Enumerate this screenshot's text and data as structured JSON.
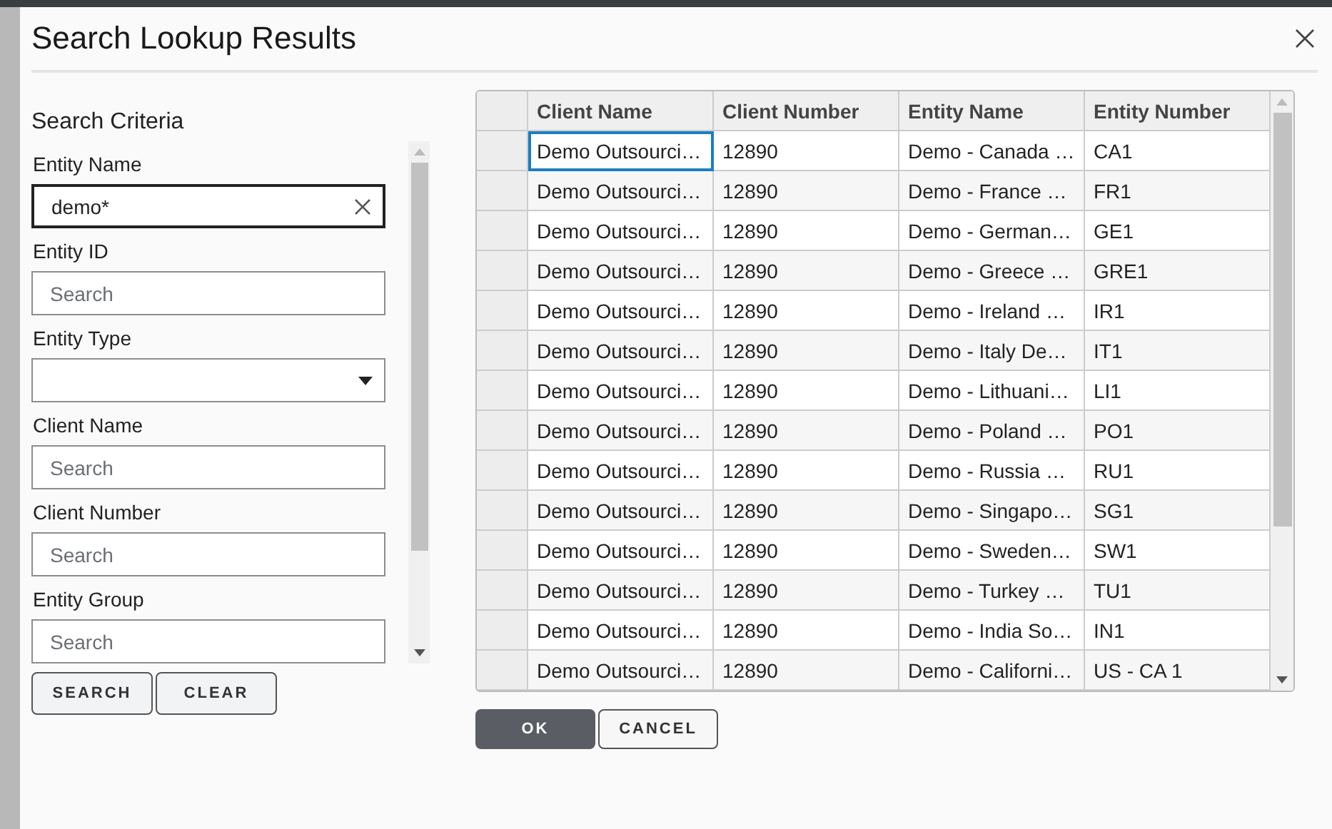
{
  "dialog": {
    "title": "Search Lookup Results"
  },
  "criteria": {
    "heading": "Search Criteria",
    "fields": [
      {
        "label": "Entity Name",
        "kind": "text",
        "value": "demo*",
        "focused": true
      },
      {
        "label": "Entity ID",
        "kind": "text",
        "placeholder": "Search",
        "focused": false
      },
      {
        "label": "Entity Type",
        "kind": "select",
        "focused": false
      },
      {
        "label": "Client Name",
        "kind": "text",
        "placeholder": "Search",
        "focused": false
      },
      {
        "label": "Client Number",
        "kind": "text",
        "placeholder": "Search",
        "focused": false
      },
      {
        "label": "Entity Group",
        "kind": "text",
        "placeholder": "Search",
        "focused": false
      }
    ],
    "buttons": [
      "SEARCH",
      "CLEAR"
    ]
  },
  "table": {
    "columns": [
      "Client Name",
      "Client Number",
      "Entity Name",
      "Entity Number"
    ],
    "rows": [
      {
        "cells": [
          "Demo Outsourci…",
          "12890",
          "Demo - Canada …",
          "CA1"
        ],
        "focused": true
      },
      {
        "cells": [
          "Demo Outsourci…",
          "12890",
          "Demo - France …",
          "FR1"
        ],
        "focused": false
      },
      {
        "cells": [
          "Demo Outsourci…",
          "12890",
          "Demo - German…",
          "GE1"
        ],
        "focused": false
      },
      {
        "cells": [
          "Demo Outsourci…",
          "12890",
          "Demo - Greece …",
          "GRE1"
        ],
        "focused": false
      },
      {
        "cells": [
          "Demo Outsourci…",
          "12890",
          "Demo - Ireland …",
          "IR1"
        ],
        "focused": false
      },
      {
        "cells": [
          "Demo Outsourci…",
          "12890",
          "Demo - Italy De…",
          "IT1"
        ],
        "focused": false
      },
      {
        "cells": [
          "Demo Outsourci…",
          "12890",
          "Demo - Lithuani…",
          "LI1"
        ],
        "focused": false
      },
      {
        "cells": [
          "Demo Outsourci…",
          "12890",
          "Demo - Poland …",
          "PO1"
        ],
        "focused": false
      },
      {
        "cells": [
          "Demo Outsourci…",
          "12890",
          "Demo - Russia …",
          "RU1"
        ],
        "focused": false
      },
      {
        "cells": [
          "Demo Outsourci…",
          "12890",
          "Demo - Singapo…",
          "SG1"
        ],
        "focused": false
      },
      {
        "cells": [
          "Demo Outsourci…",
          "12890",
          "Demo - Sweden…",
          "SW1"
        ],
        "focused": false
      },
      {
        "cells": [
          "Demo Outsourci…",
          "12890",
          "Demo - Turkey …",
          "TU1"
        ],
        "focused": false
      },
      {
        "cells": [
          "Demo Outsourci…",
          "12890",
          "Demo - India So…",
          "IN1"
        ],
        "focused": false
      },
      {
        "cells": [
          "Demo Outsourci…",
          "12890",
          "Demo - Californi…",
          "US - CA 1"
        ],
        "focused": false
      }
    ]
  },
  "buttons": [
    {
      "label": "OK",
      "primary": true
    },
    {
      "label": "CANCEL",
      "primary": false
    }
  ]
}
